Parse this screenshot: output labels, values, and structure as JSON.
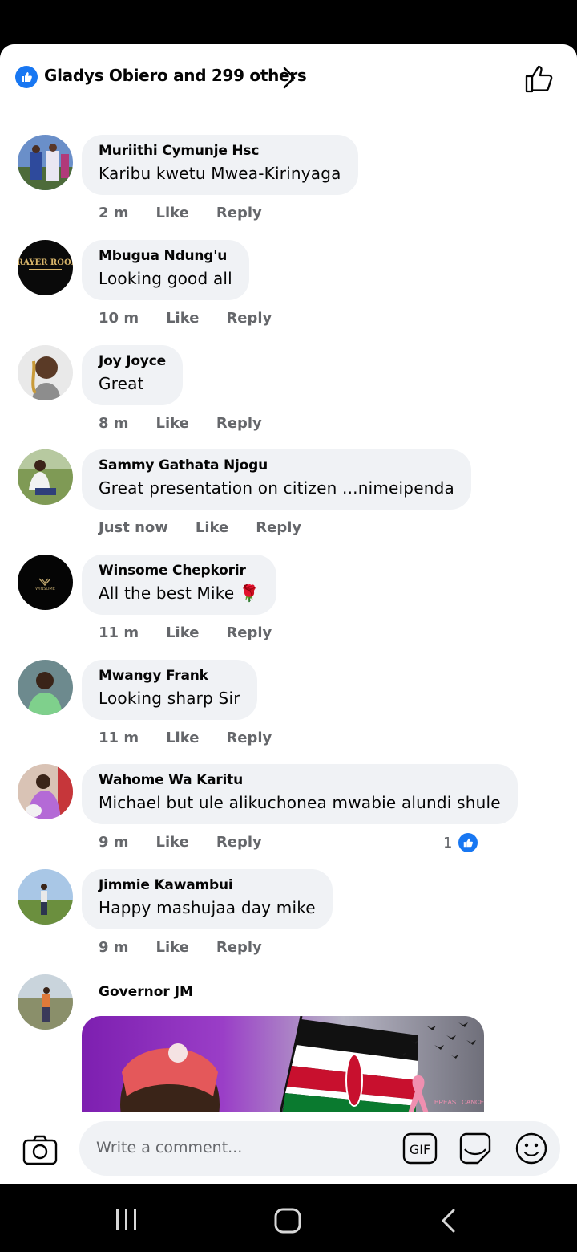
{
  "header": {
    "reactors_text": "Gladys Obiero and 299 others"
  },
  "comments": [
    {
      "author": "Muriithi Cymunje Hsc",
      "text": "Karibu kwetu Mwea-Kirinyaga",
      "time": "2 m",
      "like": "Like",
      "reply": "Reply"
    },
    {
      "author": "Mbugua Ndung'u",
      "text": "Looking good all",
      "time": "10 m",
      "like": "Like",
      "reply": "Reply"
    },
    {
      "author": "Joy Joyce",
      "text": "Great",
      "time": "8 m",
      "like": "Like",
      "reply": "Reply"
    },
    {
      "author": "Sammy Gathata Njogu",
      "text": "Great presentation on citizen ...nimeipenda",
      "time": "Just now",
      "like": "Like",
      "reply": "Reply"
    },
    {
      "author": "Winsome Chepkorir",
      "text": "All the best Mike 🌹",
      "time": "11 m",
      "like": "Like",
      "reply": "Reply"
    },
    {
      "author": "Mwangy Frank",
      "text": "Looking sharp Sir",
      "time": "11 m",
      "like": "Like",
      "reply": "Reply"
    },
    {
      "author": "Wahome Wa Karitu",
      "text": "Michael but ule alikuchonea mwabie alundi shule",
      "time": "9 m",
      "like": "Like",
      "reply": "Reply",
      "reaction_count": "1"
    },
    {
      "author": "Jimmie Kawambui",
      "text": "Happy mashujaa day mike",
      "time": "9 m",
      "like": "Like",
      "reply": "Reply"
    },
    {
      "author": "Governor JM"
    }
  ],
  "avatar_labels": {
    "prayer_room": "PRAYER ROOM",
    "winsome": "WINSOME"
  },
  "media_labels": {
    "ribbon_text": "BREAST CANCER"
  },
  "composer": {
    "placeholder": "Write a comment...",
    "gif_label": "GIF"
  },
  "colors": {
    "accent": "#1877f2",
    "bubble": "#f0f2f5",
    "meta_text": "#65676b"
  }
}
